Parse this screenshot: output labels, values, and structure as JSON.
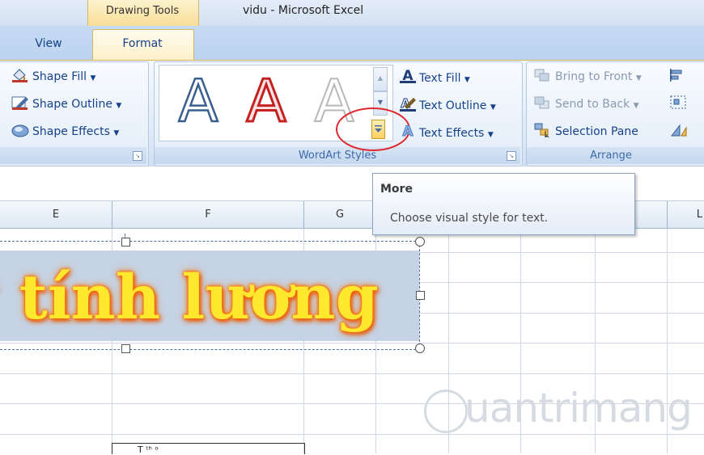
{
  "titlebar": {
    "context_tab": "Drawing Tools",
    "document_title": "vidu - Microsoft Excel"
  },
  "tabs": {
    "view": "View",
    "format": "Format"
  },
  "ribbon": {
    "shape_styles": {
      "shape_fill": "Shape Fill",
      "shape_outline": "Shape Outline",
      "shape_effects": "Shape Effects"
    },
    "wordart": {
      "gallery_letter": "A",
      "text_fill": "Text Fill",
      "text_outline": "Text Outline",
      "text_effects": "Text Effects",
      "group_label": "WordArt Styles"
    },
    "arrange": {
      "bring_to_front": "Bring to Front",
      "send_to_back": "Send to Back",
      "selection_pane": "Selection Pane",
      "group_label": "Arrange"
    }
  },
  "tooltip": {
    "title": "More",
    "description": "Choose visual style for text."
  },
  "columns": [
    "E",
    "F",
    "G"
  ],
  "sheet": {
    "wordart_text": "g tính lương",
    "bottom_cell_text": "Τ      ᵗʰ ᵒ"
  },
  "watermark": "uantrimang",
  "colors": {
    "highlight_circle": "#e0282f",
    "wordart_fill": "#ffe82e",
    "wordart_glow": "#ff6a00",
    "ribbon_blue": "#15428b"
  }
}
